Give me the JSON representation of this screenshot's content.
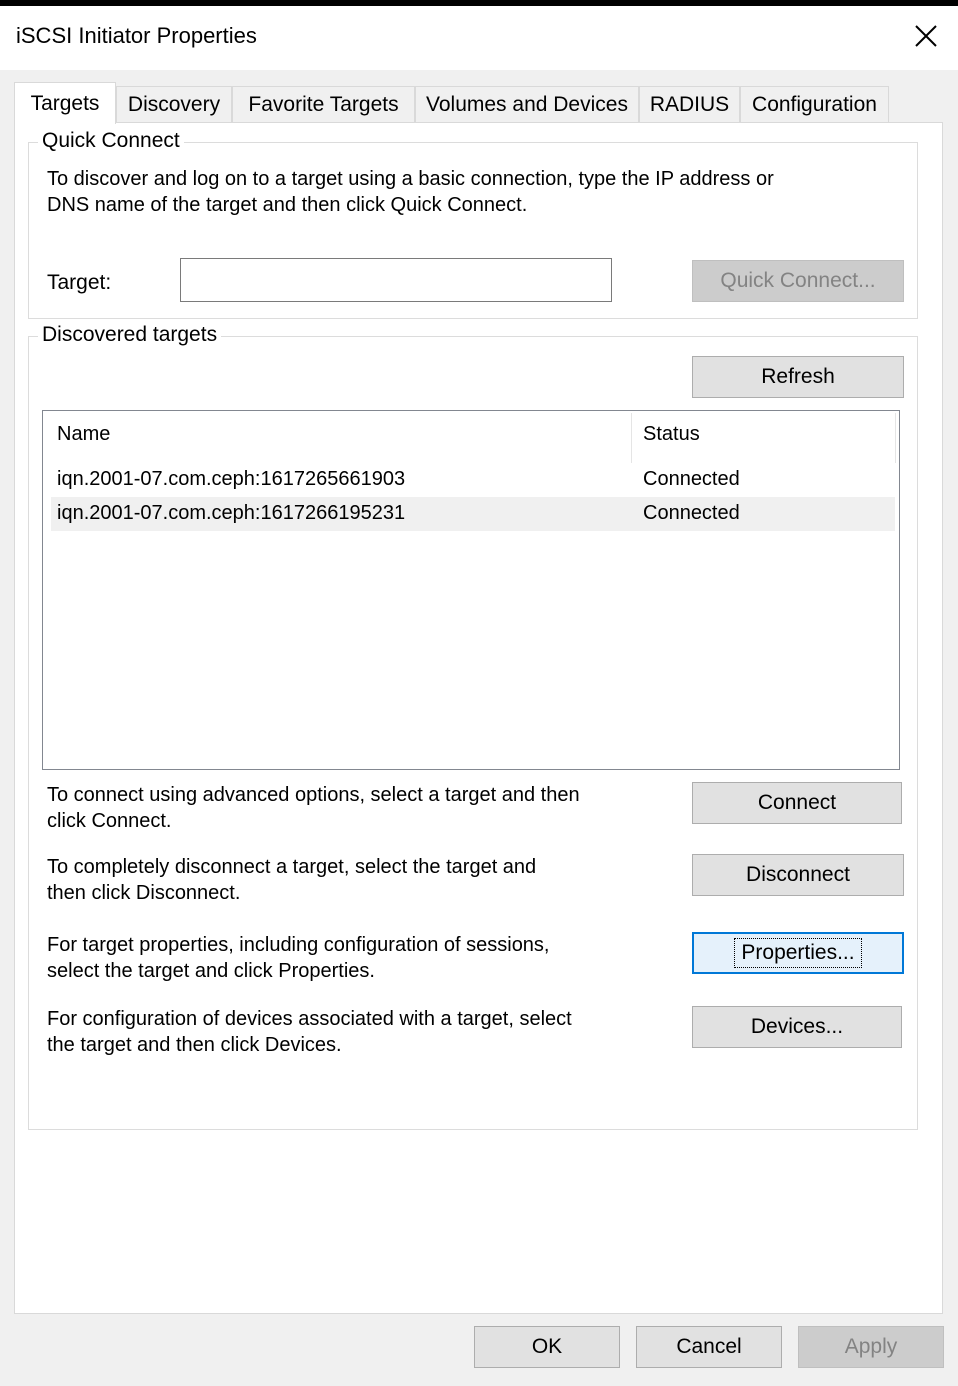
{
  "window": {
    "title": "iSCSI Initiator Properties"
  },
  "tabs": [
    "Targets",
    "Discovery",
    "Favorite Targets",
    "Volumes and Devices",
    "RADIUS",
    "Configuration"
  ],
  "quick_connect": {
    "legend": "Quick Connect",
    "description_line1": "To discover and log on to a target using a basic connection, type the IP address or",
    "description_line2": "DNS name of the target and then click Quick Connect.",
    "target_label": "Target:",
    "target_value": "",
    "button": "Quick Connect..."
  },
  "discovered": {
    "legend": "Discovered targets",
    "refresh_button": "Refresh",
    "columns": [
      "Name",
      "Status"
    ],
    "rows": [
      {
        "name": "iqn.2001-07.com.ceph:1617265661903",
        "status": "Connected"
      },
      {
        "name": "iqn.2001-07.com.ceph:1617266195231",
        "status": "Connected"
      }
    ],
    "connect_text_1": "To connect using advanced options, select a target and then",
    "connect_text_2": "click Connect.",
    "connect_button": "Connect",
    "disconnect_text_1": "To completely disconnect a target, select the target and",
    "disconnect_text_2": "then click Disconnect.",
    "disconnect_button": "Disconnect",
    "properties_text_1": "For target properties, including configuration of sessions,",
    "properties_text_2": "select the target and click Properties.",
    "properties_button": "Properties...",
    "devices_text_1": "For configuration of devices associated with a target, select",
    "devices_text_2": "the target and then click Devices.",
    "devices_button": "Devices..."
  },
  "footer": {
    "ok": "OK",
    "cancel": "Cancel",
    "apply": "Apply"
  }
}
